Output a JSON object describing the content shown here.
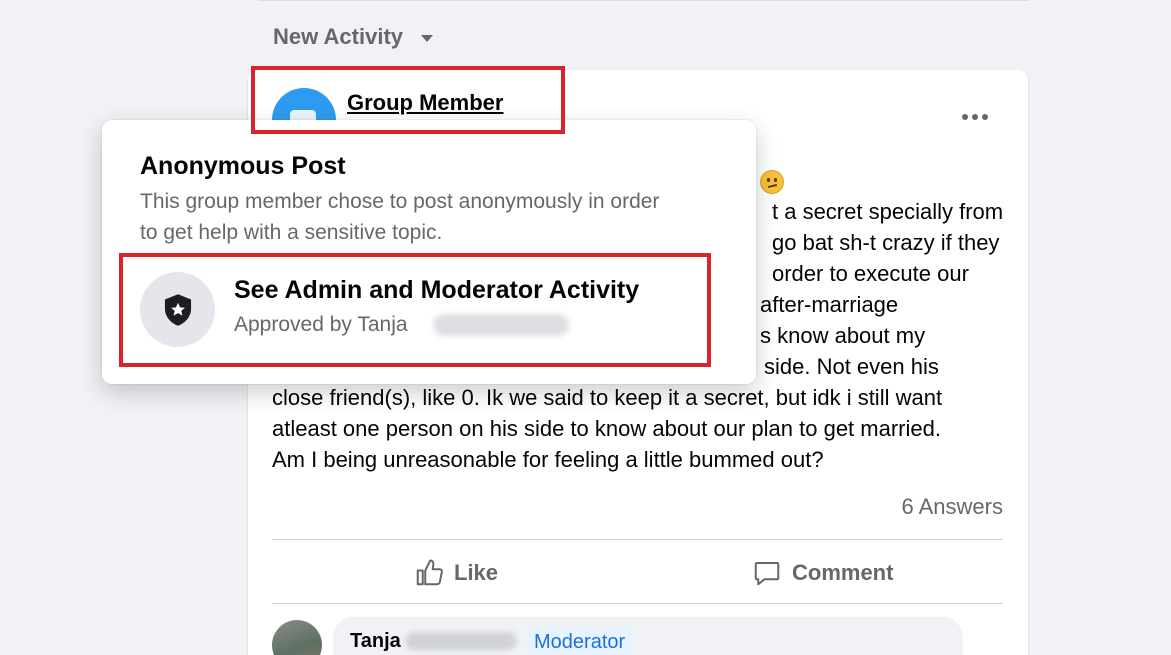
{
  "sort": {
    "label": "New Activity"
  },
  "post": {
    "author": "Group Member",
    "lines": [
      "t a secret specially from",
      "go bat sh-t crazy if they",
      "order to execute our",
      "after-marriage",
      "s know about my",
      "side. Not even his",
      "close friend(s), like 0. Ik we said to keep it a secret, but idk i still want",
      "atleast one person on his side to know about our plan to get married.",
      "Am I being unreasonable for feeling a little bummed out?"
    ],
    "answers": "6 Answers",
    "like_label": "Like",
    "comment_label": "Comment"
  },
  "comment": {
    "name": "Tanja",
    "badge": "Moderator"
  },
  "popover": {
    "title": "Anonymous Post",
    "description": "This group member chose to post anonymously in order to get help with a sensitive topic.",
    "option_title": "See Admin and Moderator Activity",
    "option_subtitle": "Approved by Tanja"
  },
  "colors": {
    "highlight": "#d9232d",
    "accent": "#216fdb",
    "anon_avatar": "#2d9cf0"
  },
  "icons": [
    "caret-down-icon",
    "more-icon",
    "like-icon",
    "comment-icon",
    "shield-star-icon"
  ]
}
